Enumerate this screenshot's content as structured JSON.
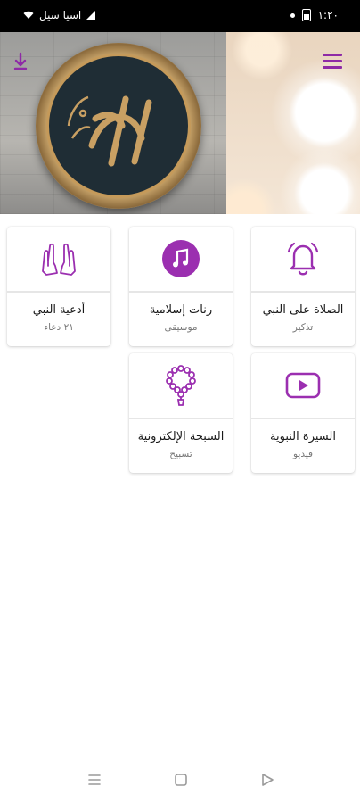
{
  "status_bar": {
    "carrier": "اسيا سيل",
    "time": "١:٢٠"
  },
  "header": {
    "menu_icon": "hamburger-menu-icon",
    "download_icon": "download-icon",
    "accent_color": "#8e2aa6"
  },
  "cards": [
    {
      "title": "الصلاة على النبي",
      "subtitle": "تذكير",
      "icon": "bell-icon"
    },
    {
      "title": "رنات إسلامية",
      "subtitle": "موسيقى",
      "icon": "music-note-icon"
    },
    {
      "title": "أدعية النبي",
      "subtitle": "٢١ دعاء",
      "icon": "praying-hands-icon"
    },
    {
      "title": "السيرة النبوية",
      "subtitle": "فيديو",
      "icon": "play-video-icon"
    },
    {
      "title": "السبحة الإلكترونية",
      "subtitle": "تسبيح",
      "icon": "prayer-beads-icon"
    }
  ],
  "nav_bar": {
    "menu": "recent-apps-icon",
    "home": "home-icon",
    "back": "back-icon"
  }
}
